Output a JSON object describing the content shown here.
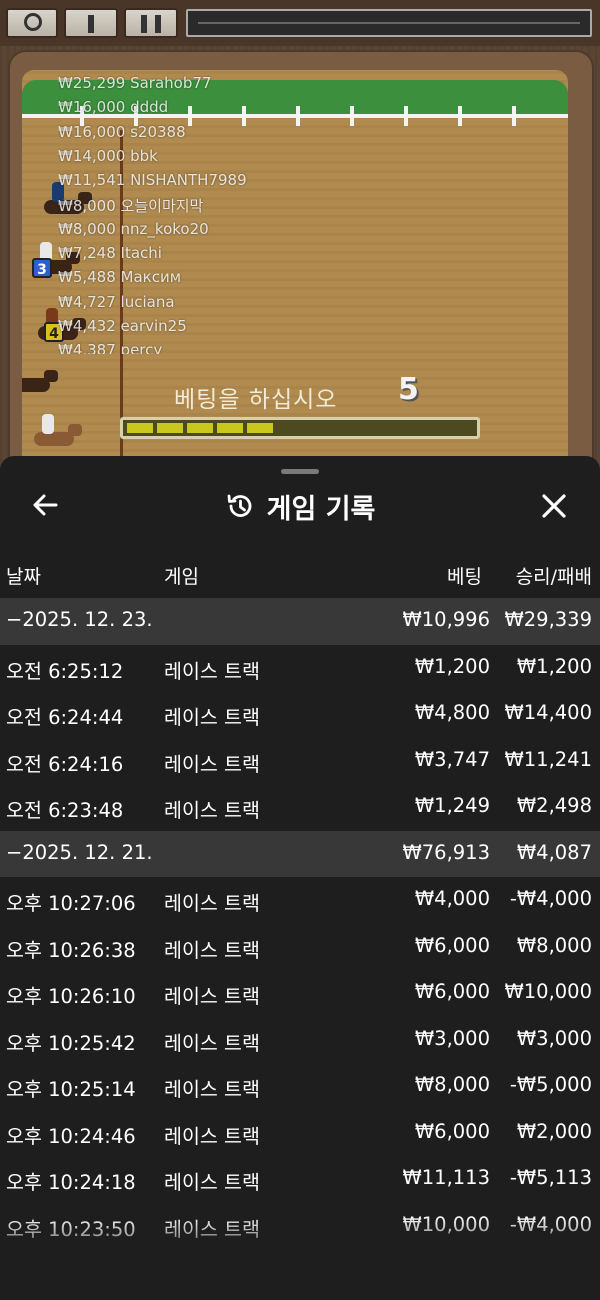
{
  "game": {
    "leaderboard": [
      "₩25,299 Sarahob77",
      "₩16,000 dddd",
      "₩16,000 s20388",
      "₩14,000 bbk",
      "₩11,541 NISHANTH7989",
      "₩8,000 오늘이마지막",
      "₩8,000 nnz_koko20",
      "₩7,248 Itachi",
      "₩5,488 Максим",
      "₩4,727 luciana",
      "₩4,432 earvin25",
      "₩4,387 percy"
    ],
    "bet_prompt": "베팅을  하십시오",
    "countdown": "5",
    "horse_numbers": [
      "3",
      "4"
    ],
    "timer_fraction": 0.42
  },
  "history": {
    "title": "게임 기록",
    "columns": {
      "date": "날짜",
      "game": "게임",
      "bet": "베팅",
      "win_loss": "승리/패배"
    },
    "rows": [
      {
        "type": "group",
        "date": "−2025. 12. 23.",
        "game": "",
        "bet": "₩10,996",
        "wl": "₩29,339"
      },
      {
        "type": "item",
        "date": "오전 6:25:12",
        "game": "레이스 트랙",
        "bet": "₩1,200",
        "wl": "₩1,200"
      },
      {
        "type": "item",
        "date": "오전 6:24:44",
        "game": "레이스 트랙",
        "bet": "₩4,800",
        "wl": "₩14,400"
      },
      {
        "type": "item",
        "date": "오전 6:24:16",
        "game": "레이스 트랙",
        "bet": "₩3,747",
        "wl": "₩11,241"
      },
      {
        "type": "item",
        "date": "오전 6:23:48",
        "game": "레이스 트랙",
        "bet": "₩1,249",
        "wl": "₩2,498"
      },
      {
        "type": "group",
        "date": "−2025. 12. 21.",
        "game": "",
        "bet": "₩76,913",
        "wl": "₩4,087"
      },
      {
        "type": "item",
        "date": "오후 10:27:06",
        "game": "레이스 트랙",
        "bet": "₩4,000",
        "wl": "-₩4,000"
      },
      {
        "type": "item",
        "date": "오후 10:26:38",
        "game": "레이스 트랙",
        "bet": "₩6,000",
        "wl": "₩8,000"
      },
      {
        "type": "item",
        "date": "오후 10:26:10",
        "game": "레이스 트랙",
        "bet": "₩6,000",
        "wl": "₩10,000"
      },
      {
        "type": "item",
        "date": "오후 10:25:42",
        "game": "레이스 트랙",
        "bet": "₩3,000",
        "wl": "₩3,000"
      },
      {
        "type": "item",
        "date": "오후 10:25:14",
        "game": "레이스 트랙",
        "bet": "₩8,000",
        "wl": "-₩5,000"
      },
      {
        "type": "item",
        "date": "오후 10:24:46",
        "game": "레이스 트랙",
        "bet": "₩6,000",
        "wl": "₩2,000"
      },
      {
        "type": "item",
        "date": "오후 10:24:18",
        "game": "레이스 트랙",
        "bet": "₩11,113",
        "wl": "-₩5,113"
      },
      {
        "type": "item",
        "date": "오후 10:23:50",
        "game": "레이스 트랙",
        "bet": "₩10,000",
        "wl": "-₩4,000"
      }
    ]
  },
  "icons": {
    "back": "arrow-left-icon",
    "history": "history-clock-icon",
    "close": "close-icon"
  },
  "colors": {
    "sheet_bg": "#1e1e1e",
    "group_row_bg": "#383838",
    "timer_fill": "#c9c81e",
    "grass": "#3c8f3c",
    "track": "#b08a4e"
  }
}
